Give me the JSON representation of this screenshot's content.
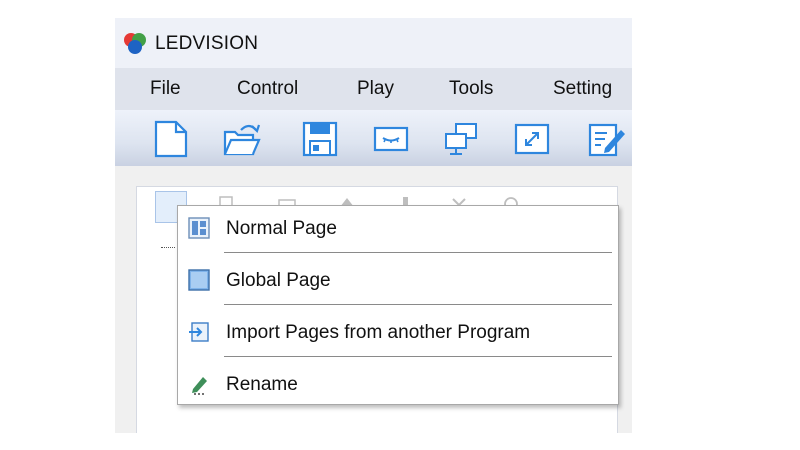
{
  "window": {
    "title": "LEDVISION",
    "logo_icon": "ledvision-logo-icon"
  },
  "menubar": {
    "items": [
      "File",
      "Control",
      "Play",
      "Tools",
      "Setting"
    ]
  },
  "toolbar": {
    "buttons": [
      "new-file-icon",
      "open-folder-icon",
      "save-icon",
      "screen-icon",
      "network-icon",
      "fullscreen-icon",
      "edit-icon"
    ]
  },
  "context_menu": {
    "items": [
      {
        "label": "Normal Page",
        "icon": "normal-page-icon"
      },
      {
        "label": "Global Page",
        "icon": "global-page-icon"
      },
      {
        "label": "Import Pages from another Program",
        "icon": "import-pages-icon"
      },
      {
        "label": "Rename",
        "icon": "rename-icon"
      }
    ]
  },
  "colors": {
    "toolbar_icon": "#2e86de",
    "menubar_bg": "#dfe3ec",
    "highlight": "#e3eefb"
  }
}
